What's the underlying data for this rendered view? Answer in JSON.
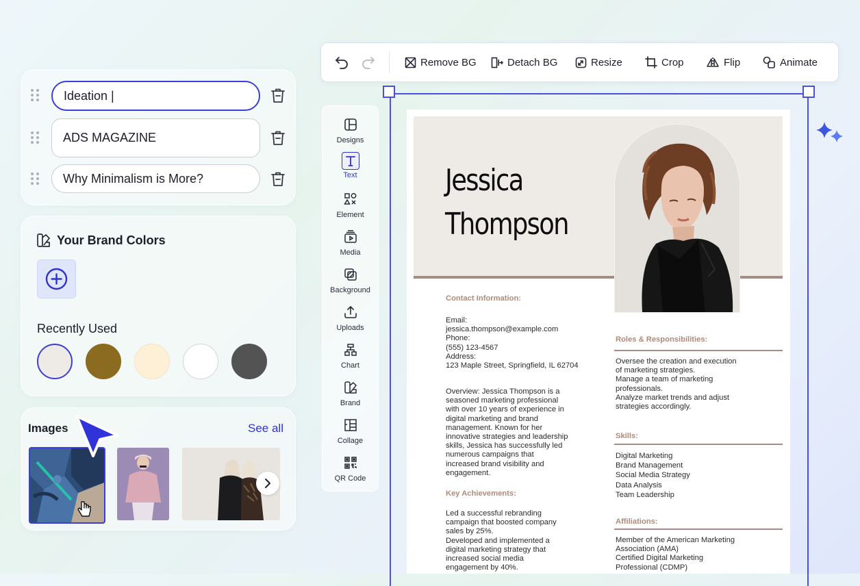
{
  "text_items": [
    {
      "value": "Ideation |",
      "active": true
    },
    {
      "value": "ADS MAGAZINE",
      "active": false
    },
    {
      "value": "Why Minimalism is More?",
      "active": false
    }
  ],
  "brand": {
    "title": "Your Brand Colors",
    "recent_title": "Recently Used",
    "recent_colors": [
      "#eeeae6",
      "#8b6b1f",
      "#fdf0d6",
      "#ffffff",
      "#535353"
    ]
  },
  "images": {
    "title": "Images",
    "see_all": "See all"
  },
  "toolbar": {
    "remove_bg": "Remove BG",
    "detach_bg": "Detach BG",
    "resize": "Resize",
    "crop": "Crop",
    "flip": "Flip",
    "animate": "Animate"
  },
  "rail": [
    {
      "label": "Designs",
      "icon": "layout-icon"
    },
    {
      "label": "Text",
      "icon": "text-icon"
    },
    {
      "label": "Element",
      "icon": "shapes-icon"
    },
    {
      "label": "Media",
      "icon": "media-icon"
    },
    {
      "label": "Background",
      "icon": "background-icon"
    },
    {
      "label": "Uploads",
      "icon": "upload-icon"
    },
    {
      "label": "Chart",
      "icon": "chart-icon"
    },
    {
      "label": "Brand",
      "icon": "brand-icon"
    },
    {
      "label": "Collage",
      "icon": "collage-icon"
    },
    {
      "label": "QR Code",
      "icon": "qr-code-icon"
    }
  ],
  "resume": {
    "first_name": "Jessica",
    "last_name": "Thompson",
    "contact_title": "Contact Information:",
    "contact_lines": [
      "Email:",
      "jessica.thompson@example.com",
      "Phone:",
      "(555) 123-4567",
      "Address:",
      "123 Maple Street, Springfield, IL 62704"
    ],
    "overview_lines": [
      "Overview: Jessica Thompson is a",
      "seasoned marketing professional",
      "with over 10 years of experience in",
      "digital marketing and brand",
      "management. Known for her",
      "innovative strategies and leadership",
      "skills, Jessica has successfully led",
      "numerous campaigns that",
      "increased brand visibility and",
      "engagement."
    ],
    "achievements_title": "Key Achievements:",
    "achievements_lines": [
      "Led a successful rebranding",
      "campaign that boosted company",
      "sales by 25%.",
      "Developed and implemented a",
      "digital marketing strategy that",
      "increased social media",
      "engagement by 40%."
    ],
    "roles_title": "Roles & Responsibilities:",
    "roles_lines": [
      "Oversee the creation and execution",
      "of marketing strategies.",
      "Manage a team of marketing",
      "professionals.",
      "Analyze market trends and adjust",
      "strategies accordingly."
    ],
    "skills_title": "Skills:",
    "skills_lines": [
      "Digital Marketing",
      "Brand Management",
      "Social Media Strategy",
      "Data Analysis",
      "Team Leadership"
    ],
    "affiliations_title": "Affiliations:",
    "affiliations_lines": [
      "Member of the American Marketing",
      "Association (AMA)",
      "Certified Digital Marketing",
      "Professional (CDMP)"
    ]
  },
  "colors": {
    "accent": "#3b3fd8",
    "selection": "#4a4fe0",
    "resume_accent": "#b08a7a",
    "header_bg": "#eeebe6"
  }
}
